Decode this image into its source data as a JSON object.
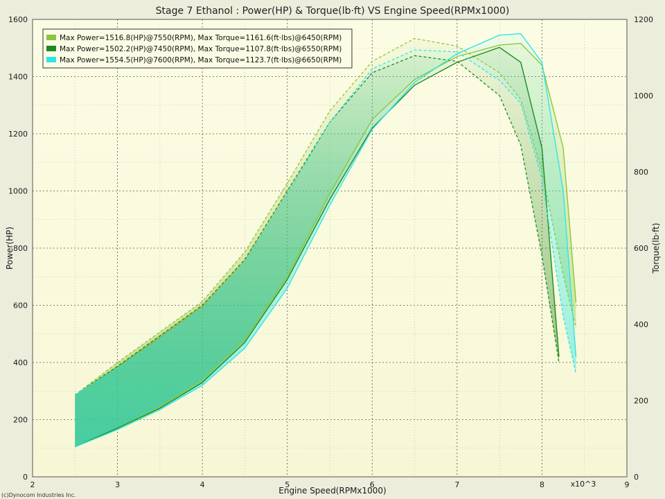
{
  "chart_data": {
    "type": "line",
    "title": "Stage 7 Ethanol : Power(HP) & Torque(lb·ft) VS Engine Speed(RPMx1000)",
    "xlabel": "Engine Speed(RPMx1000)",
    "ylabel_left": "Power(HP)",
    "ylabel_right": "Torque(lb·ft)",
    "x_multiplier_label": "x10^3",
    "copyright": "(c)Dynocom Industries Inc.",
    "xlim": [
      2,
      9
    ],
    "ylim_left": [
      0,
      1600
    ],
    "ylim_right": [
      0,
      1200
    ],
    "x_ticks": [
      "2",
      "3",
      "4",
      "5",
      "6",
      "7",
      "8",
      "9"
    ],
    "y_ticks_left": [
      "0",
      "200",
      "400",
      "600",
      "800",
      "1000",
      "1200",
      "1400",
      "1600"
    ],
    "y_ticks_right": [
      "0",
      "200",
      "400",
      "600",
      "800",
      "1000",
      "1200"
    ],
    "grid": true,
    "legend_position": "top-left",
    "series": [
      {
        "name": "Max Power=1516.8(HP)@7550(RPM), Max Torque=1161.6(ft·lbs)@6450(RPM)",
        "color": "#8cc63f",
        "x": [
          2.5,
          3.0,
          3.5,
          4.0,
          4.5,
          5.0,
          5.5,
          6.0,
          6.5,
          7.0,
          7.5,
          7.75,
          8.0,
          8.25,
          8.4
        ],
        "power": [
          105,
          170,
          245,
          340,
          480,
          700,
          990,
          1250,
          1390,
          1470,
          1510,
          1516,
          1440,
          1150,
          610
        ],
        "torque": [
          215,
          300,
          380,
          460,
          590,
          770,
          960,
          1090,
          1150,
          1130,
          1060,
          990,
          800,
          530,
          390
        ]
      },
      {
        "name": "Max Power=1502.2(HP)@7450(RPM), Max Torque=1107.8(ft·lbs)@6550(RPM)",
        "color": "#1f8a1f",
        "x": [
          2.5,
          3.0,
          3.5,
          4.0,
          4.5,
          5.0,
          5.5,
          6.0,
          6.5,
          7.0,
          7.5,
          7.75,
          8.0,
          8.2
        ],
        "power": [
          105,
          170,
          240,
          330,
          470,
          690,
          970,
          1220,
          1370,
          1450,
          1502,
          1450,
          1150,
          420
        ],
        "torque": [
          215,
          290,
          370,
          450,
          570,
          750,
          930,
          1060,
          1105,
          1090,
          1000,
          870,
          580,
          300
        ]
      },
      {
        "name": "Max Power=1554.5(HP)@7600(RPM), Max Torque=1123.7(ft·lbs)@6650(RPM)",
        "color": "#2ee6e6",
        "x": [
          2.5,
          3.0,
          3.5,
          4.0,
          4.5,
          5.0,
          5.5,
          6.0,
          6.5,
          7.0,
          7.5,
          7.75,
          8.0,
          8.25,
          8.4
        ],
        "power": [
          105,
          165,
          235,
          320,
          450,
          660,
          950,
          1215,
          1380,
          1480,
          1545,
          1550,
          1450,
          1000,
          420
        ],
        "torque": [
          215,
          285,
          360,
          440,
          560,
          740,
          930,
          1070,
          1120,
          1115,
          1040,
          980,
          780,
          420,
          270
        ]
      }
    ]
  }
}
